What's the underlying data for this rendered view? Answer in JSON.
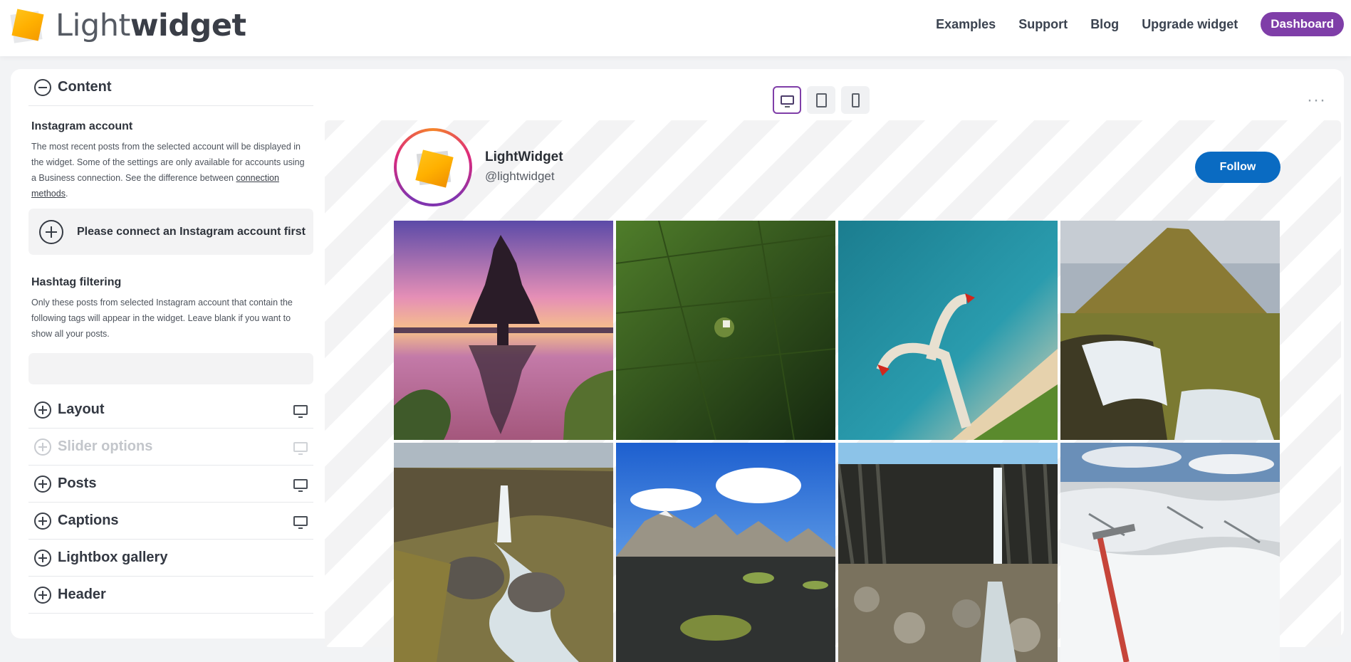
{
  "app": {
    "logo_light": "Light",
    "logo_bold": "widget"
  },
  "nav": {
    "links": [
      "Examples",
      "Support",
      "Blog",
      "Upgrade widget"
    ],
    "dashboard": "Dashboard"
  },
  "sidebar": {
    "content_title": "Content",
    "instagram": {
      "title": "Instagram account",
      "help_part1": "The most recent posts from the selected account will be displayed in the widget. Some of the settings are only available for accounts using a Business connection. See the difference between ",
      "help_link": "connection methods",
      "help_part2": ".",
      "connect_label": "Please connect an Instagram account first"
    },
    "hashtag": {
      "title": "Hashtag filtering",
      "help": "Only these posts from selected Instagram account that contain the following tags will appear in the widget. Leave blank if you want to show all your posts.",
      "value": ""
    },
    "sections": [
      {
        "label": "Layout"
      },
      {
        "label": "Slider options",
        "disabled": true
      },
      {
        "label": "Posts"
      },
      {
        "label": "Captions"
      },
      {
        "label": "Lightbox gallery"
      },
      {
        "label": "Header"
      }
    ]
  },
  "preview": {
    "more_label": "···",
    "profile": {
      "name": "LightWidget",
      "handle": "@lightwidget",
      "follow": "Follow"
    },
    "photos": [
      "pagoda-sunset-photo",
      "green-field-aerial-photo",
      "sea-pier-aerial-photo",
      "mountain-waterfall-photo",
      "river-waterfall-photo",
      "snowy-mountains-lake-photo",
      "basalt-waterfall-photo",
      "glacier-ice-axe-photo"
    ]
  }
}
